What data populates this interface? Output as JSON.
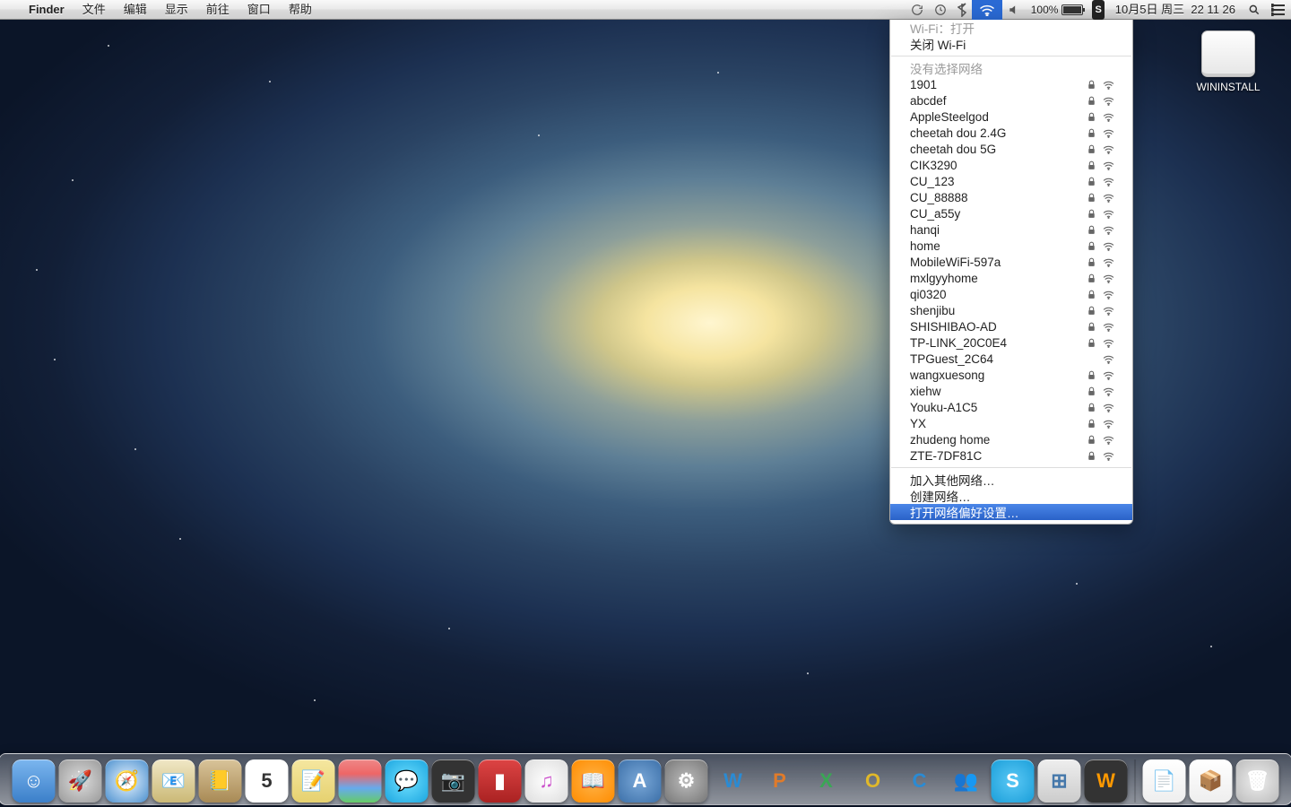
{
  "menubar": {
    "app_name": "Finder",
    "items": [
      "文件",
      "编辑",
      "显示",
      "前往",
      "窗口",
      "帮助"
    ],
    "battery_pct": "100%",
    "date": "10月5日",
    "weekday": "周三",
    "time": "22 11 26"
  },
  "wifi_menu": {
    "status_label": "Wi-Fi：打开",
    "toggle_label": "关闭 Wi-Fi",
    "no_network_label": "没有选择网络",
    "networks": [
      {
        "name": "1901",
        "locked": true
      },
      {
        "name": "abcdef",
        "locked": true
      },
      {
        "name": "AppleSteelgod",
        "locked": true
      },
      {
        "name": "cheetah dou 2.4G",
        "locked": true
      },
      {
        "name": "cheetah dou 5G",
        "locked": true
      },
      {
        "name": "CIK3290",
        "locked": true
      },
      {
        "name": "CU_123",
        "locked": true
      },
      {
        "name": "CU_88888",
        "locked": true
      },
      {
        "name": "CU_a55y",
        "locked": true
      },
      {
        "name": "hanqi",
        "locked": true
      },
      {
        "name": "home",
        "locked": true
      },
      {
        "name": "MobileWiFi-597a",
        "locked": true
      },
      {
        "name": "mxlgyyhome",
        "locked": true
      },
      {
        "name": "qi0320",
        "locked": true
      },
      {
        "name": "shenjibu",
        "locked": true
      },
      {
        "name": "SHISHIBAO-AD",
        "locked": true
      },
      {
        "name": "TP-LINK_20C0E4",
        "locked": true
      },
      {
        "name": "TPGuest_2C64",
        "locked": false
      },
      {
        "name": "wangxuesong",
        "locked": true
      },
      {
        "name": "xiehw",
        "locked": true
      },
      {
        "name": "Youku-A1C5",
        "locked": true
      },
      {
        "name": "YX",
        "locked": true
      },
      {
        "name": "zhudeng home",
        "locked": true
      },
      {
        "name": "ZTE-7DF81C",
        "locked": true
      }
    ],
    "join_other_label": "加入其他网络…",
    "create_network_label": "创建网络…",
    "open_prefs_label": "打开网络偏好设置…"
  },
  "desktop": {
    "drive_label": "WININSTALL"
  },
  "dock": {
    "items": [
      {
        "name": "finder",
        "bg": "linear-gradient(#7bb6ef,#3b7fc9)",
        "glyph": "☺"
      },
      {
        "name": "launchpad",
        "bg": "radial-gradient(#ddd,#999)",
        "glyph": "🚀"
      },
      {
        "name": "safari",
        "bg": "radial-gradient(#e8f4ff,#4a8fce)",
        "glyph": "🧭"
      },
      {
        "name": "mail",
        "bg": "linear-gradient(#f0e7c6,#cbb976)",
        "glyph": "📧"
      },
      {
        "name": "contacts",
        "bg": "linear-gradient(#d9c49a,#a88a55)",
        "glyph": "📒"
      },
      {
        "name": "calendar",
        "bg": "#fff",
        "glyph": "5",
        "color": "#333"
      },
      {
        "name": "notes",
        "bg": "linear-gradient(#f5e7a0,#e6d16f)",
        "glyph": "📝"
      },
      {
        "name": "reminders",
        "bg": "linear-gradient(#e88,#e66,#6ae,#6c6)",
        "glyph": ""
      },
      {
        "name": "messages",
        "bg": "radial-gradient(#6fe0ff,#1ba6e0)",
        "glyph": "💬"
      },
      {
        "name": "facetime",
        "bg": "#333",
        "glyph": "📷",
        "color": "#6c6"
      },
      {
        "name": "photobooth",
        "bg": "linear-gradient(#d44,#a22)",
        "glyph": "▮"
      },
      {
        "name": "itunes",
        "bg": "radial-gradient(#fff,#ddd)",
        "glyph": "♫",
        "color": "#c5c"
      },
      {
        "name": "ibooks",
        "bg": "radial-gradient(#ffb347,#ff8c00)",
        "glyph": "📖"
      },
      {
        "name": "appstore",
        "bg": "radial-gradient(#7aa8d8,#3b6fa8)",
        "glyph": "A"
      },
      {
        "name": "preferences",
        "bg": "radial-gradient(#bbb,#777)",
        "glyph": "⚙"
      },
      {
        "name": "wps-w",
        "bg": "transparent",
        "glyph": "W",
        "color": "#2a8bd4",
        "shadow": "none"
      },
      {
        "name": "wps-p",
        "bg": "transparent",
        "glyph": "P",
        "color": "#e07b2a",
        "shadow": "none"
      },
      {
        "name": "wps-x",
        "bg": "transparent",
        "glyph": "X",
        "color": "#3aa655",
        "shadow": "none"
      },
      {
        "name": "letter-o",
        "bg": "transparent",
        "glyph": "O",
        "color": "#e0b82a",
        "shadow": "none"
      },
      {
        "name": "letter-c",
        "bg": "transparent",
        "glyph": "C",
        "color": "#2a8bd4",
        "shadow": "none"
      },
      {
        "name": "msn",
        "bg": "transparent",
        "glyph": "👥",
        "color": "#5a5",
        "shadow": "none"
      },
      {
        "name": "skype",
        "bg": "radial-gradient(#5ac8f5,#1a9ed9)",
        "glyph": "S"
      },
      {
        "name": "vm",
        "bg": "linear-gradient(#eee,#ccc)",
        "glyph": "⊞",
        "color": "#47a"
      },
      {
        "name": "walkman",
        "bg": "#333",
        "glyph": "W",
        "color": "#f90"
      }
    ],
    "right": [
      {
        "name": "documents",
        "bg": "linear-gradient(#fff,#eee)",
        "glyph": "📄"
      },
      {
        "name": "downloads",
        "bg": "linear-gradient(#fff,#eee)",
        "glyph": "📦"
      },
      {
        "name": "trash",
        "bg": "radial-gradient(#eee,#bbb)",
        "glyph": "🗑"
      }
    ]
  }
}
